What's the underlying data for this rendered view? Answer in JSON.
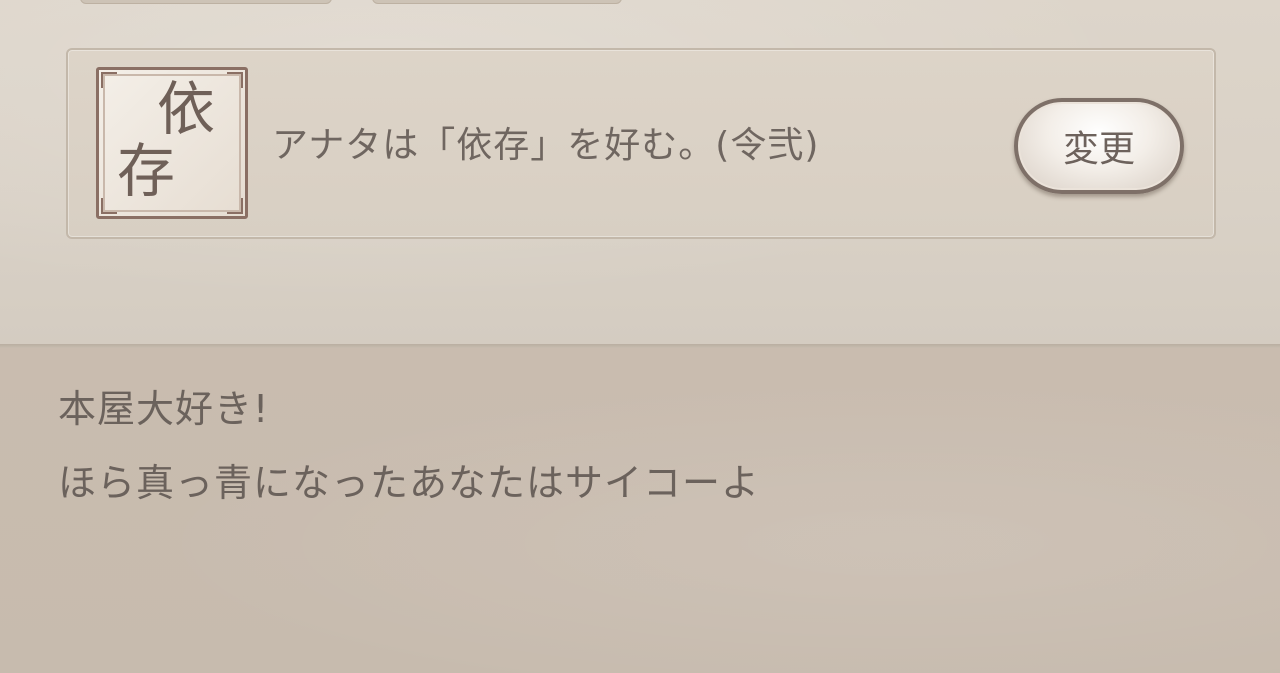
{
  "preference": {
    "emblem_char_1": "依",
    "emblem_char_2": "存",
    "text": "アナタは「依存」を好む。(令弐)",
    "change_button_label": "変更"
  },
  "dialogue": {
    "line1": "本屋大好き!",
    "line2": "ほら真っ青になったあなたはサイコーよ"
  }
}
